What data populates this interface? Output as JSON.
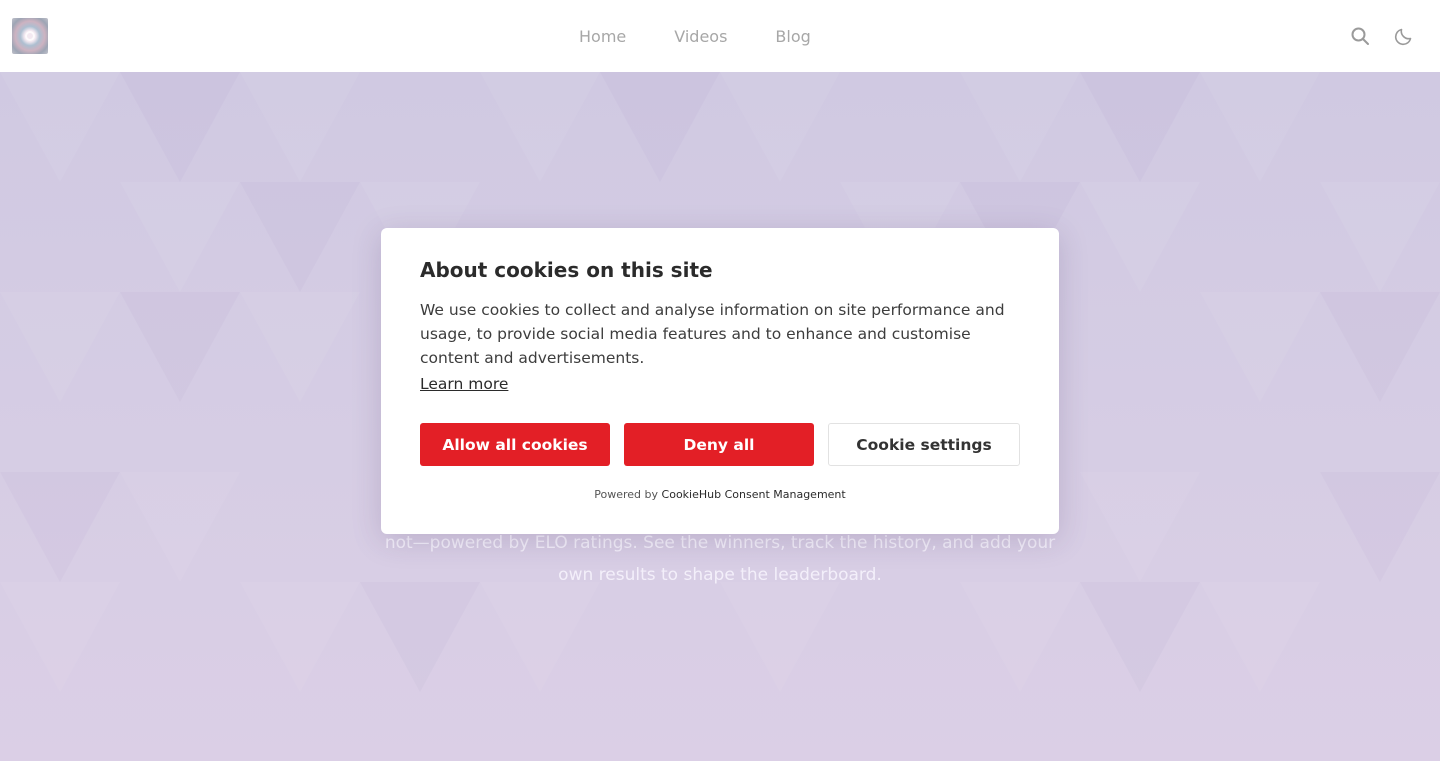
{
  "header": {
    "logo_icon": "app-logo",
    "nav": [
      {
        "label": "Home"
      },
      {
        "label": "Videos"
      },
      {
        "label": "Blog"
      }
    ],
    "icons": [
      "search-icon",
      "moon-icon"
    ]
  },
  "hero": {
    "description_line1": "not—powered by ELO ratings. See the winners, track the history, and add your",
    "description_line2": "own results to shape the leaderboard."
  },
  "cookie_modal": {
    "title": "About cookies on this site",
    "body": "We use cookies to collect and analyse information on site performance and usage, to provide social media features and to enhance and customise content and advertisements.",
    "learn_more": "Learn more",
    "allow_all": "Allow all cookies",
    "deny_all": "Deny all",
    "settings": "Cookie settings",
    "powered_prefix": "Powered by",
    "powered_brand": "CookieHub Consent Management"
  },
  "colors": {
    "accent_red": "#e31f26",
    "hero_bg": "#d6cde4",
    "nav_text": "#a7a7a7"
  }
}
